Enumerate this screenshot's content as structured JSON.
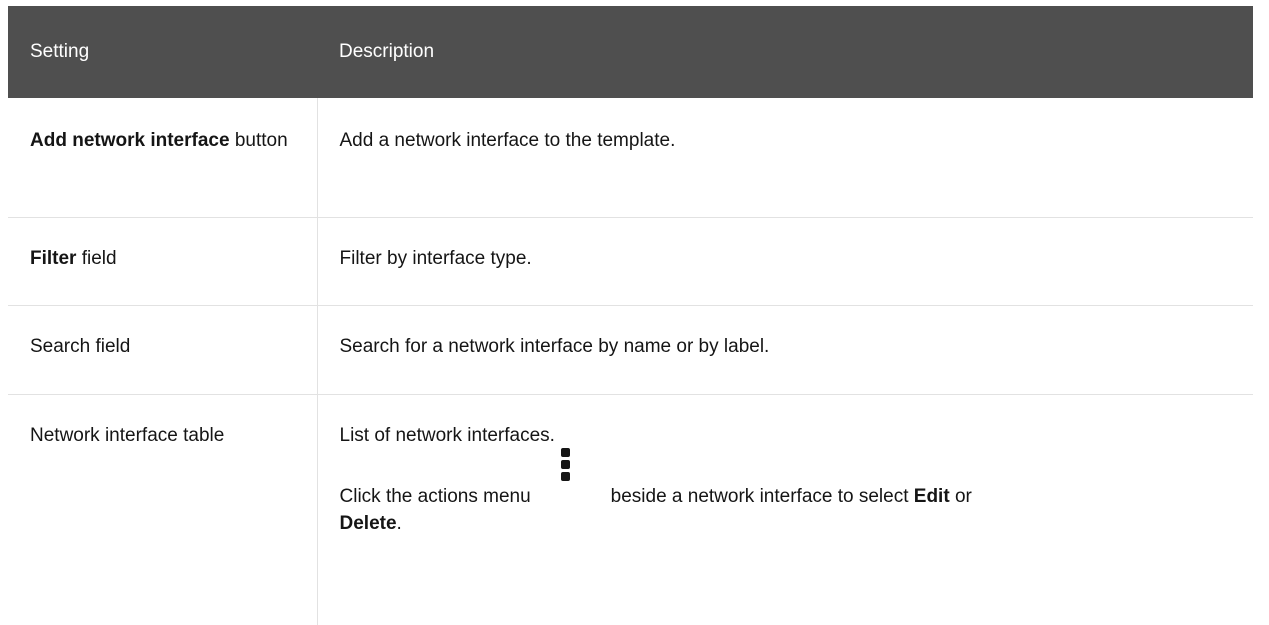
{
  "header": {
    "setting": "Setting",
    "description": "Description"
  },
  "rows": [
    {
      "setting_bold": "Add network interface",
      "setting_rest": "button",
      "description": "Add a network interface to the template."
    },
    {
      "setting_bold": "Filter",
      "setting_rest": "field",
      "description": "Filter by interface type."
    },
    {
      "setting": "Search field",
      "description": "Search for a network interface by name or by label."
    },
    {
      "setting": "Network interface table",
      "description": "List of network interfaces.",
      "action_prefix": "Click the actions menu",
      "action_icon": "kebab-icon",
      "action_middle": "beside a network interface to select",
      "action_edit": "Edit",
      "action_or": "or",
      "action_delete": "Delete",
      "action_end": "."
    }
  ]
}
